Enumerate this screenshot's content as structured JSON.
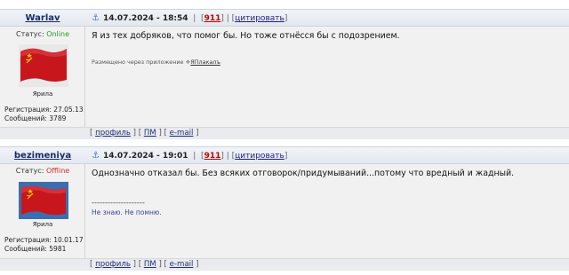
{
  "posts": [
    {
      "username": "Warlav",
      "date": "14.07.2024 - 18:54",
      "count": "911",
      "quote_label": "цитировать",
      "status_label": "Статус:",
      "status_value": "Online",
      "status_color": "#2a9b2a",
      "avatar_caption": "Ярила",
      "reg_label": "Регистрация: 27.05.13",
      "msgs_label": "Сообщений: 3789",
      "message": "Я из тех добряков, что помог бы. Но тоже отнёсся бы с подозрением.",
      "via_prefix": "Размещено через приложение",
      "via_link": "ЯПлакалъ",
      "footer": {
        "profile": "профиль",
        "pm": "ПМ",
        "email": "e-mail"
      }
    },
    {
      "username": "bezimeniya",
      "date": "14.07.2024 - 19:01",
      "count": "911",
      "quote_label": "цитировать",
      "status_label": "Статус:",
      "status_value": "Offline",
      "status_color": "#d22c2c",
      "avatar_caption": "Ярила",
      "reg_label": "Регистрация: 10.01.17",
      "msgs_label": "Сообщений: 5981",
      "message": "Однозначно отказал бы. Без всяких отговорок/придумываний...потому что вредный и жадный.",
      "signature_divider": "--------------------",
      "signature": "Не знаю. Не помню.",
      "footer": {
        "profile": "профиль",
        "pm": "ПМ",
        "email": "e-mail"
      }
    }
  ]
}
